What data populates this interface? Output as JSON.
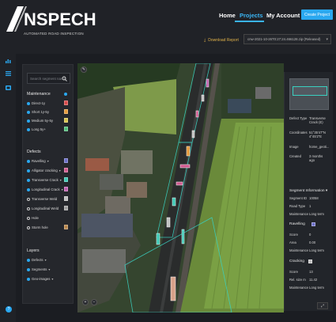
{
  "brand": {
    "name": "NSPECH",
    "tagline": "AUTOMATED ROAD INSPECTION"
  },
  "nav": {
    "home": "Home",
    "projects": "Projects",
    "account": "My Account",
    "create": "Create Project"
  },
  "toolbar": {
    "download": "Download Report",
    "file": "cnw-2021-10-26T0:27:24.466128.zip (Released)"
  },
  "search": {
    "placeholder": "Search segment name"
  },
  "maintenance": {
    "title": "Maintenance",
    "items": [
      {
        "label": "Direct-1y",
        "color": "#d94a4a"
      },
      {
        "label": "Short 1y-5y",
        "color": "#e49a3a"
      },
      {
        "label": "Medium 5y-5y",
        "color": "#d7c24a"
      },
      {
        "label": "Long 5y+",
        "color": "#4fbf7a"
      }
    ]
  },
  "defects": {
    "title": "Defects",
    "items": [
      {
        "label": "Ravelling",
        "color": "#6b6ec9"
      },
      {
        "label": "Alligator cracking",
        "color": "#d05a8f"
      },
      {
        "label": "Transverse Crack",
        "color": "#3ec9b5"
      },
      {
        "label": "Longitudinal Crack",
        "color": "#c15fb0"
      },
      {
        "label": "Transverse Weld",
        "color": "#bfbfbf"
      },
      {
        "label": "Longitudinal Weld",
        "color": "#a0a0a0"
      },
      {
        "label": "Hole",
        "color": ""
      },
      {
        "label": "Storm hole",
        "color": "#b8864a"
      }
    ]
  },
  "layers": {
    "title": "Layers",
    "items": [
      {
        "label": "Defects"
      },
      {
        "label": "Segments"
      },
      {
        "label": "Geo-images"
      }
    ]
  },
  "panel": {
    "defect_type_key": "Defect Type",
    "defect_type_val": "Transverse Crack (E)",
    "coordinates_key": "Coordinates",
    "coordinates_val": "51°35'47\"N 4°45'2\"E",
    "image_key": "Image",
    "image_val": "home_geoti...",
    "created_key": "Created",
    "created_val": "3 months ago",
    "segment_info_title": "Segment Information",
    "segment_id_key": "Segment ID",
    "segment_id_val": "10058",
    "road_type_key": "Road Type",
    "road_type_val": "1",
    "maint1_key": "Maintenance",
    "maint1_val": "Long term",
    "ravelling_title": "Ravelling",
    "score1_key": "Score",
    "score1_val": "0",
    "area_key": "Area",
    "area_val": "0.00",
    "maint2_key": "Maintenance",
    "maint2_val": "Long term",
    "cracking_title": "Cracking",
    "score2_key": "Score",
    "score2_val": "13",
    "rel_size_key": "Rel. size m",
    "rel_size_val": "11.42",
    "maint3_key": "Maintenance",
    "maint3_val": "Long term"
  },
  "colors": {
    "accent": "#2aa8f0",
    "download": "#e0b24a",
    "selection": "#3ad0c0"
  }
}
